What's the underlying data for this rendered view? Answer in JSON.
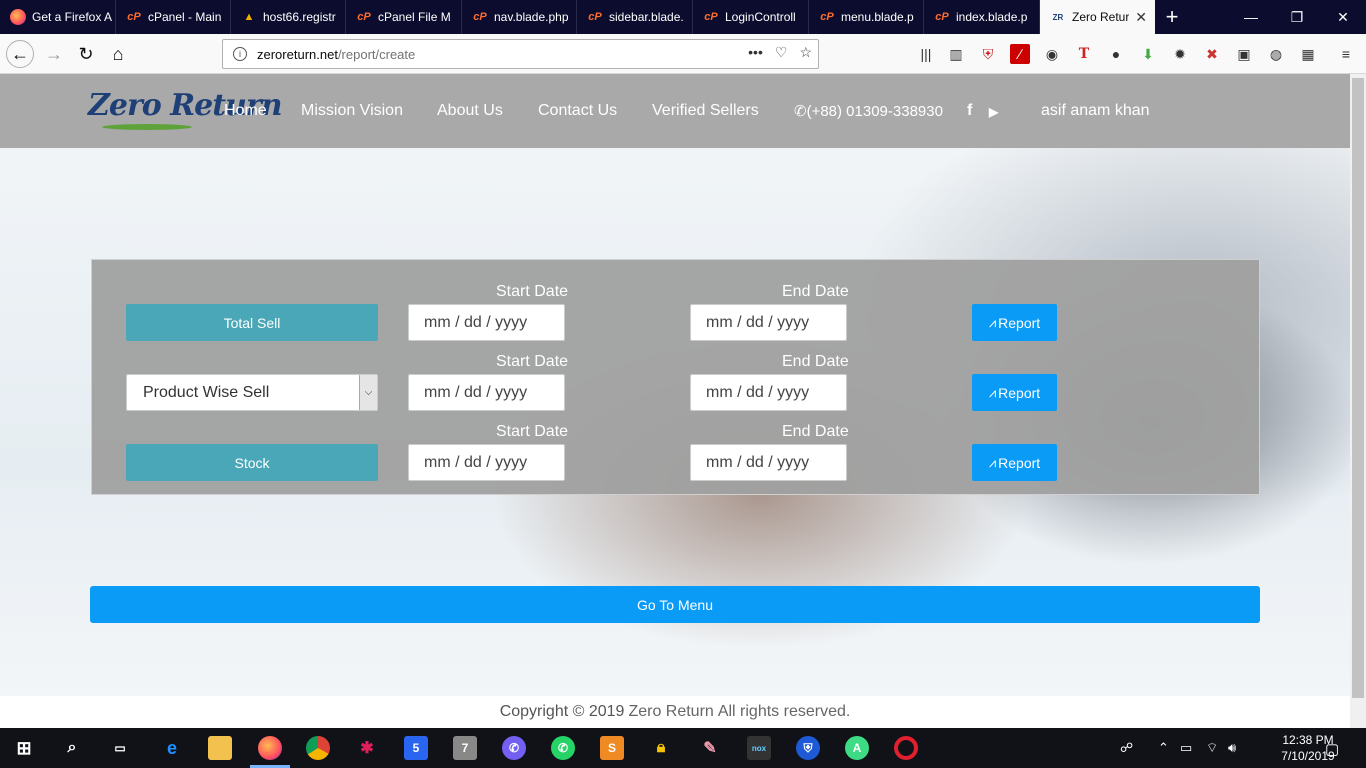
{
  "browser": {
    "tabs": [
      {
        "label": "Get a Firefox A",
        "icon": "firefox-icon"
      },
      {
        "label": "cPanel - Main",
        "icon": "cpanel-icon"
      },
      {
        "label": "host66.registr",
        "icon": "host-icon"
      },
      {
        "label": "cPanel File M",
        "icon": "cpanel-icon"
      },
      {
        "label": "nav.blade.php",
        "icon": "cpanel-icon"
      },
      {
        "label": "sidebar.blade.",
        "icon": "cpanel-icon"
      },
      {
        "label": "LoginControll",
        "icon": "cpanel-icon"
      },
      {
        "label": "menu.blade.p",
        "icon": "cpanel-icon"
      },
      {
        "label": "index.blade.p",
        "icon": "cpanel-icon"
      },
      {
        "label": "Zero Retur",
        "icon": "zero-return-icon",
        "active": true
      }
    ],
    "url_host": "zeroreturn.net",
    "url_path": "/report/create"
  },
  "site": {
    "logo_text": "Zero Return",
    "menu": [
      "Home",
      "Mission Vision",
      "About Us",
      "Contact Us",
      "Verified Sellers"
    ],
    "phone": "(+88) 01309-338930",
    "username": "asif anam khan"
  },
  "report_panel": {
    "rows": [
      {
        "type": "button",
        "label": "Total Sell",
        "start_label": "Start Date",
        "end_label": "End Date",
        "start_placeholder": "mm / dd / yyyy",
        "end_placeholder": "mm / dd / yyyy",
        "report_label": "Report"
      },
      {
        "type": "select",
        "label": "Product Wise Sell",
        "start_label": "Start Date",
        "end_label": "End Date",
        "start_placeholder": "mm / dd / yyyy",
        "end_placeholder": "mm / dd / yyyy",
        "report_label": "Report"
      },
      {
        "type": "button",
        "label": "Stock",
        "start_label": "Start Date",
        "end_label": "End Date",
        "start_placeholder": "mm / dd / yyyy",
        "end_placeholder": "mm / dd / yyyy",
        "report_label": "Report"
      }
    ]
  },
  "goto_menu_label": "Go To Menu",
  "footer": {
    "copyright": "Copyright © 2019",
    "brand": "Zero Return",
    "rights": "All rights reserved."
  },
  "taskbar": {
    "time": "12:38 PM",
    "date": "7/10/2019"
  },
  "colors": {
    "accent_blue": "#0a9bf7",
    "teal": "#4aa7b7",
    "header_gray": "#a9a9a9"
  }
}
